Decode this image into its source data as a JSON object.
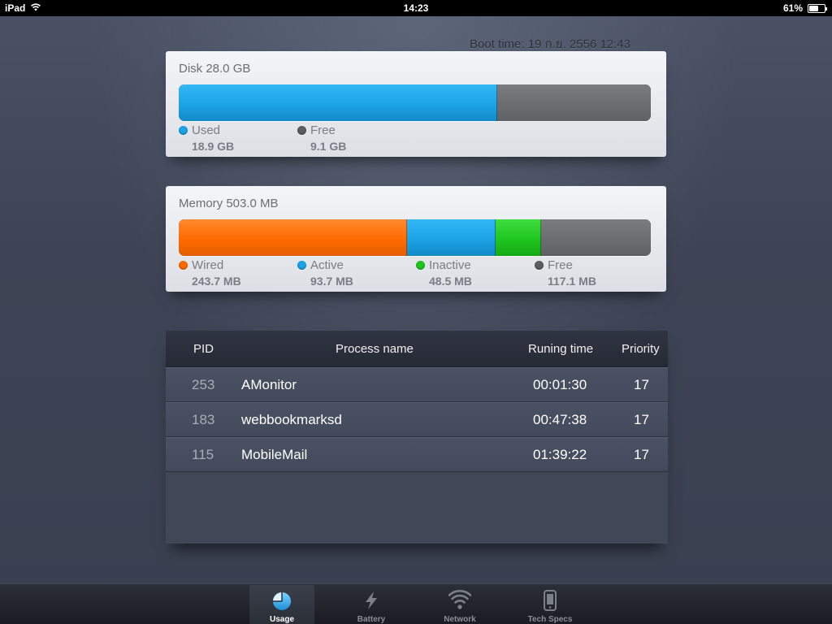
{
  "status_bar": {
    "device": "iPad",
    "time": "14:23",
    "battery_percent": "61%",
    "battery_level": 0.61
  },
  "boot_time": "Boot time: 19 ก.ย. 2556 12:43",
  "disk": {
    "title": "Disk 28.0 GB",
    "total": 28.0,
    "used": 18.9,
    "free": 9.1,
    "legend": [
      {
        "label": "Used",
        "value": "18.9 GB",
        "color": "#1ba3e6"
      },
      {
        "label": "Free",
        "value": "9.1 GB",
        "color": "#5b5d61"
      }
    ]
  },
  "memory": {
    "title": "Memory 503.0 MB",
    "total": 503.0,
    "wired": 243.7,
    "active": 93.7,
    "inactive": 48.5,
    "free": 117.1,
    "legend": [
      {
        "label": "Wired",
        "value": "243.7 MB",
        "color": "#ff6a00"
      },
      {
        "label": "Active",
        "value": "93.7 MB",
        "color": "#1ba3e6"
      },
      {
        "label": "Inactive",
        "value": "48.5 MB",
        "color": "#1ec61e"
      },
      {
        "label": "Free",
        "value": "117.1 MB",
        "color": "#5b5d61"
      }
    ]
  },
  "processes": {
    "headers": {
      "pid": "PID",
      "name": "Process name",
      "time": "Runing time",
      "priority": "Priority"
    },
    "rows": [
      {
        "pid": "253",
        "name": "AMonitor",
        "time": "00:01:30",
        "priority": "17"
      },
      {
        "pid": "183",
        "name": "webbookmarksd",
        "time": "00:47:38",
        "priority": "17"
      },
      {
        "pid": "115",
        "name": "MobileMail",
        "time": "01:39:22",
        "priority": "17"
      }
    ]
  },
  "tabs": [
    {
      "label": "Usage",
      "icon": "pie-chart-icon",
      "active": true
    },
    {
      "label": "Battery",
      "icon": "lightning-icon",
      "active": false
    },
    {
      "label": "Network",
      "icon": "wifi-icon",
      "active": false
    },
    {
      "label": "Tech Specs",
      "icon": "phone-icon",
      "active": false
    }
  ],
  "colors": {
    "used": "#1ba3e6",
    "wired": "#ff6a00",
    "active": "#1ba3e6",
    "inactive": "#1ec61e",
    "free": "#5b5d61"
  }
}
